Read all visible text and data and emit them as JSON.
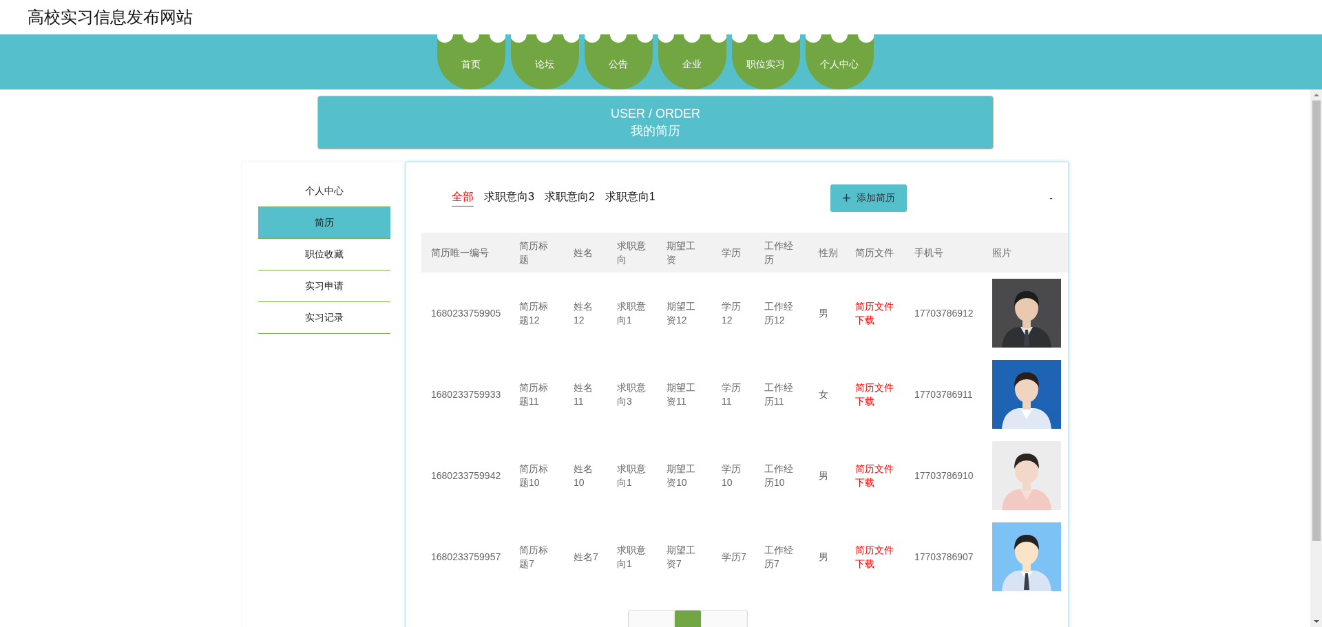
{
  "site_title": "高校实习信息发布网站",
  "nav": [
    {
      "label": "首页"
    },
    {
      "label": "论坛"
    },
    {
      "label": "公告"
    },
    {
      "label": "企业"
    },
    {
      "label": "职位实习"
    },
    {
      "label": "个人中心"
    }
  ],
  "banner": {
    "subtitle": "USER / ORDER",
    "title": "我的简历"
  },
  "sidebar": {
    "items": [
      {
        "label": "个人中心",
        "selected": false
      },
      {
        "label": "简历",
        "selected": true
      },
      {
        "label": "职位收藏",
        "selected": false
      },
      {
        "label": "实习申请",
        "selected": false
      },
      {
        "label": "实习记录",
        "selected": false
      }
    ]
  },
  "filter_tabs": [
    {
      "label": "全部",
      "selected": true
    },
    {
      "label": "求职意向3",
      "selected": false
    },
    {
      "label": "求职意向2",
      "selected": false
    },
    {
      "label": "求职意向1",
      "selected": false
    }
  ],
  "add_button": {
    "icon": "+",
    "label": "添加简历"
  },
  "collapse_toggle": "-",
  "table": {
    "columns": [
      "简历唯一编号",
      "简历标题",
      "姓名",
      "求职意向",
      "期望工资",
      "学历",
      "工作经历",
      "性别",
      "简历文件",
      "手机号",
      "照片"
    ],
    "rows": [
      {
        "id": "1680233759905",
        "title": "简历标题12",
        "name": "姓名12",
        "intention": "求职意向1",
        "salary": "期望工资12",
        "education": "学历12",
        "experience": "工作经历12",
        "gender": "男",
        "file_link": "简历文件下载",
        "phone": "17703786912"
      },
      {
        "id": "1680233759933",
        "title": "简历标题11",
        "name": "姓名11",
        "intention": "求职意向3",
        "salary": "期望工资11",
        "education": "学历11",
        "experience": "工作经历11",
        "gender": "女",
        "file_link": "简历文件下载",
        "phone": "17703786911"
      },
      {
        "id": "1680233759942",
        "title": "简历标题10",
        "name": "姓名10",
        "intention": "求职意向1",
        "salary": "期望工资10",
        "education": "学历10",
        "experience": "工作经历10",
        "gender": "男",
        "file_link": "简历文件下载",
        "phone": "17703786910"
      },
      {
        "id": "1680233759957",
        "title": "简历标题7",
        "name": "姓名7",
        "intention": "求职意向1",
        "salary": "期望工资7",
        "education": "学历7",
        "experience": "工作经历7",
        "gender": "男",
        "file_link": "简历文件下载",
        "phone": "17703786907"
      }
    ]
  },
  "pagination": {
    "pages": [
      {
        "selected": false
      },
      {
        "selected": true
      },
      {
        "selected": false
      }
    ]
  }
}
